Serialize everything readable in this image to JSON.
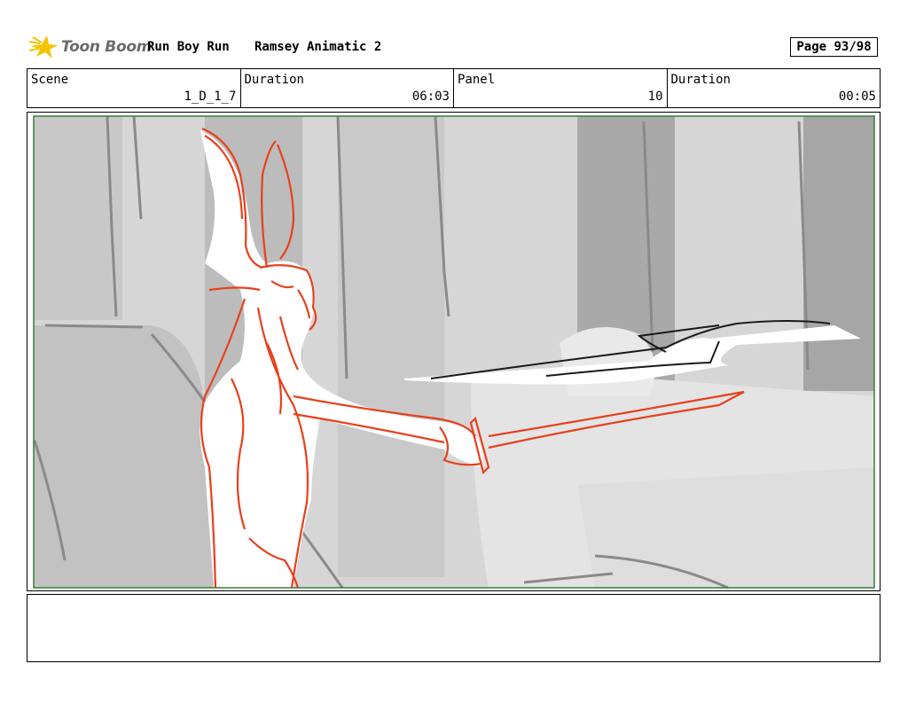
{
  "header": {
    "logo_text": "Toon Boom",
    "project": "Run Boy Run",
    "title": "Ramsey Animatic 2",
    "page": "Page 93/98"
  },
  "info": {
    "scene_label": "Scene",
    "scene_value": "1_D_1_7",
    "duration_label": "Duration",
    "duration_value": "06:03",
    "panel_label": "Panel",
    "panel_value": "10",
    "panel_duration_label": "Duration",
    "panel_duration_value": "00:05"
  },
  "colors": {
    "sketch_red": "#e8401c",
    "frame_green": "#3c7a3c"
  },
  "notes": {
    "text": ""
  }
}
